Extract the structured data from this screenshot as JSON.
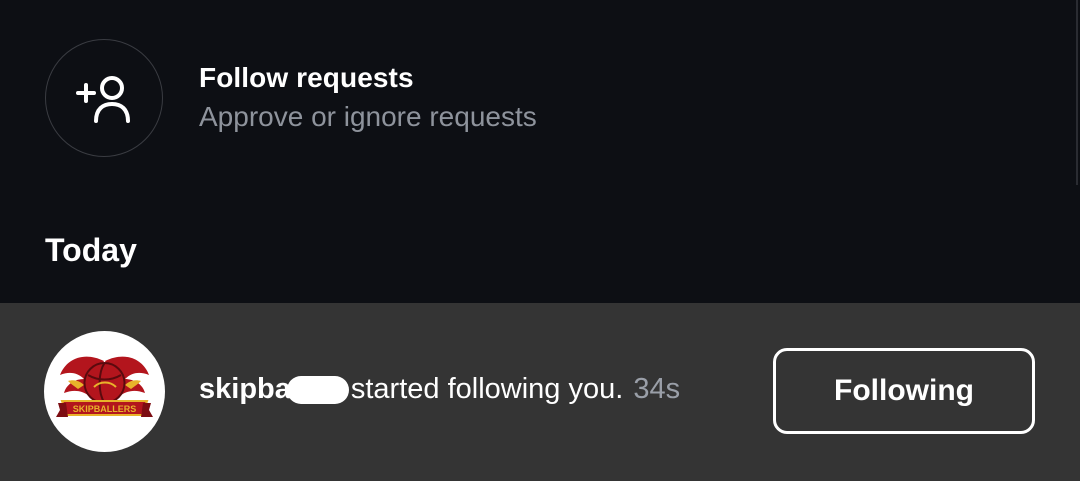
{
  "follow_requests": {
    "title": "Follow requests",
    "subtitle": "Approve or ignore requests",
    "icon": "add-person-icon"
  },
  "section": {
    "today": "Today"
  },
  "notification": {
    "username": "skipba",
    "action": "started following you.",
    "time": "34s",
    "button_label": "Following",
    "avatar_logo_text": "SKIPBALLERS"
  },
  "colors": {
    "background": "#0d0f14",
    "row_highlight": "#343434",
    "secondary_text": "#8e939c",
    "logo_red": "#b3151d",
    "logo_gold": "#e8b32a"
  }
}
